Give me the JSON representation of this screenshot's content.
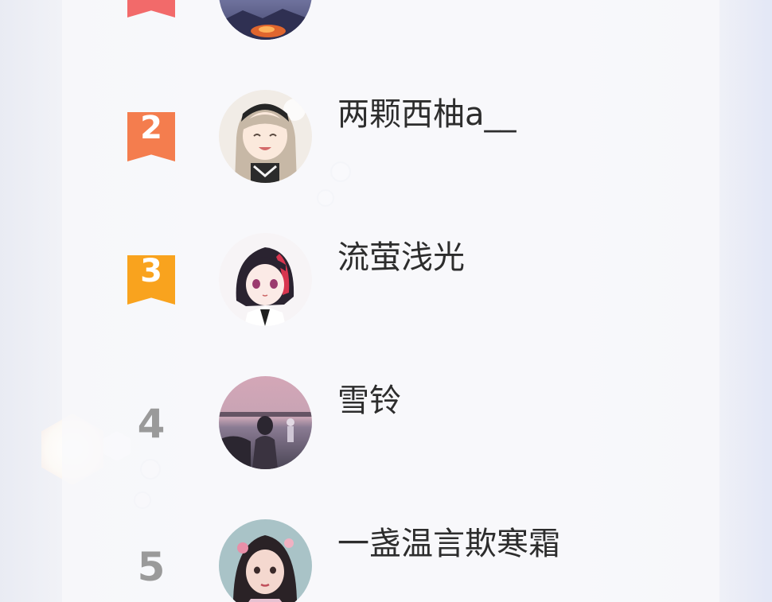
{
  "leaderboard": {
    "entries": [
      {
        "rank": "",
        "name": "",
        "badge_color": "#f26a6a",
        "avatar": "dusk-landscape-avatar"
      },
      {
        "rank": "2",
        "name": "两颗西柚a__",
        "badge_color": "#f47d4e",
        "avatar": "smiling-anime-girl-avatar"
      },
      {
        "rank": "3",
        "name": "流萤浅光",
        "badge_color": "#f9a31e",
        "avatar": "anime-girl-dark-hair-avatar"
      },
      {
        "rank": "4",
        "name": "雪铃",
        "avatar": "seaside-sunset-avatar"
      },
      {
        "rank": "5",
        "name": "一盏温言欺寒霜",
        "avatar": "girl-with-hair-ornaments-avatar"
      }
    ]
  },
  "colors": {
    "badge_rank_1": "#f26a6a",
    "badge_rank_2": "#f47d4e",
    "badge_rank_3": "#f9a31e",
    "rank_number_gray": "#9a9a9a",
    "name_text": "#2d2d2d"
  }
}
